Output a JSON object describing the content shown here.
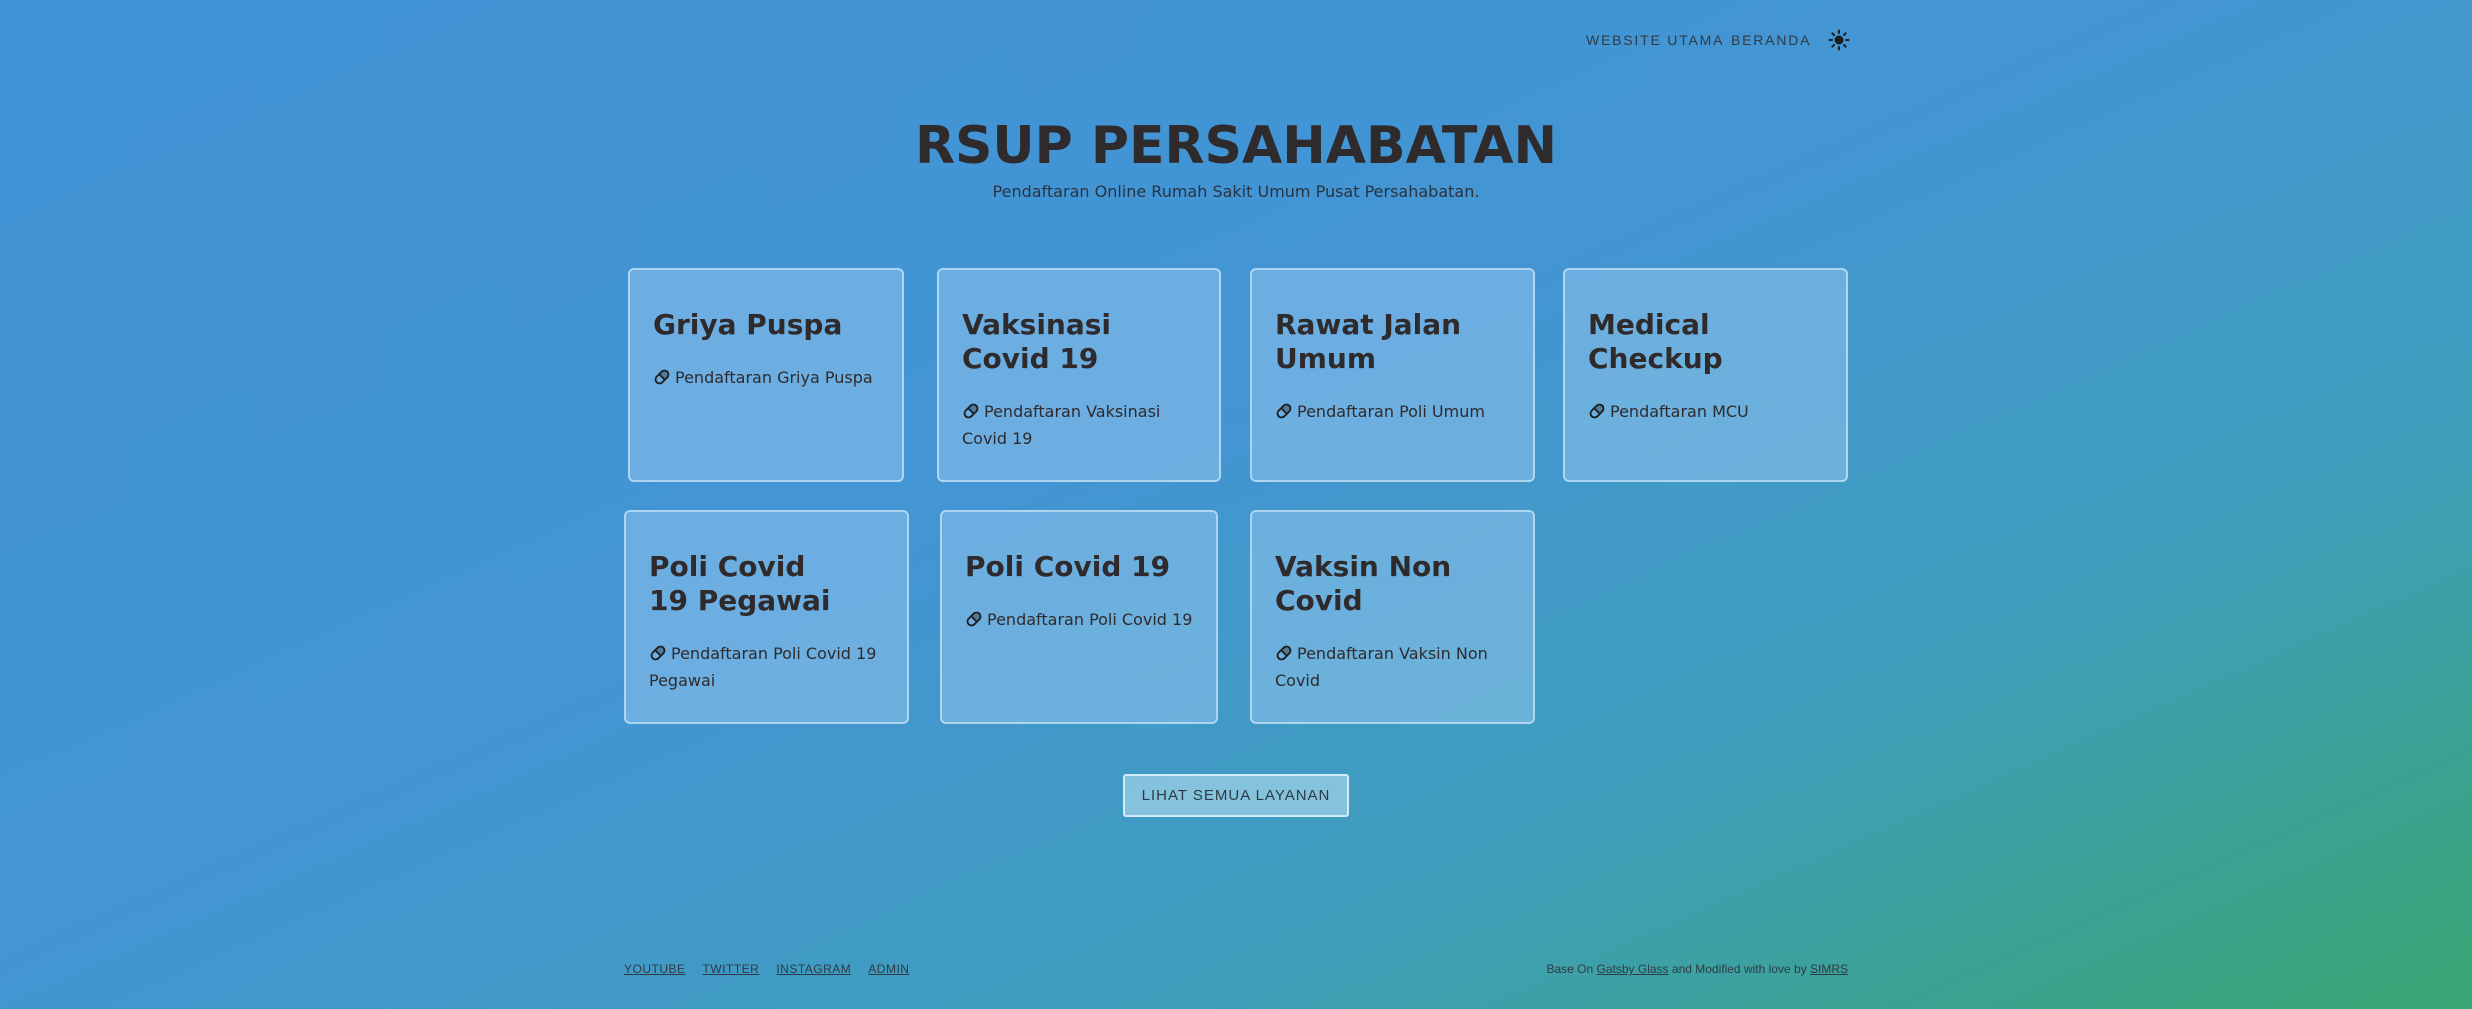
{
  "nav": {
    "website_utama": "WEBSITE UTAMA",
    "beranda": "BERANDA",
    "theme_icon": "sun-icon"
  },
  "hero": {
    "title": "RSUP PERSAHABATAN",
    "subtitle": "Pendaftaran Online Rumah Sakit Umum Pusat Persahabatan."
  },
  "cards": [
    {
      "title": "Griya Puspa",
      "desc": "Pendaftaran Griya Puspa",
      "icon": "pill-icon"
    },
    {
      "title": "Vaksinasi Covid 19",
      "desc": "Pendaftaran Vaksinasi Covid 19",
      "icon": "pill-icon"
    },
    {
      "title": "Rawat Jalan Umum",
      "desc": "Pendaftaran Poli Umum",
      "icon": "pill-icon"
    },
    {
      "title": "Medical Checkup",
      "desc": "Pendaftaran MCU",
      "icon": "pill-icon"
    },
    {
      "title": "Poli Covid 19 Pegawai",
      "desc": "Pendaftaran Poli Covid 19 Pegawai",
      "icon": "pill-icon"
    },
    {
      "title": "Poli Covid 19",
      "desc": "Pendaftaran Poli Covid 19",
      "icon": "pill-icon"
    },
    {
      "title": "Vaksin Non Covid",
      "desc": "Pendaftaran Vaksin Non Covid",
      "icon": "pill-icon"
    }
  ],
  "all_services_button": "LIHAT SEMUA LAYANAN",
  "footer": {
    "links": [
      "YOUTUBE",
      "TWITTER",
      "INSTAGRAM",
      "ADMIN"
    ],
    "credit_prefix": "Base On ",
    "credit_link1": "Gatsby Glass",
    "credit_middle": " and Modified with love by ",
    "credit_link2": "SIMRS"
  },
  "colors": {
    "gradient_start": "#4194d6",
    "gradient_end": "#38a672",
    "text": "#2f2a2c"
  }
}
